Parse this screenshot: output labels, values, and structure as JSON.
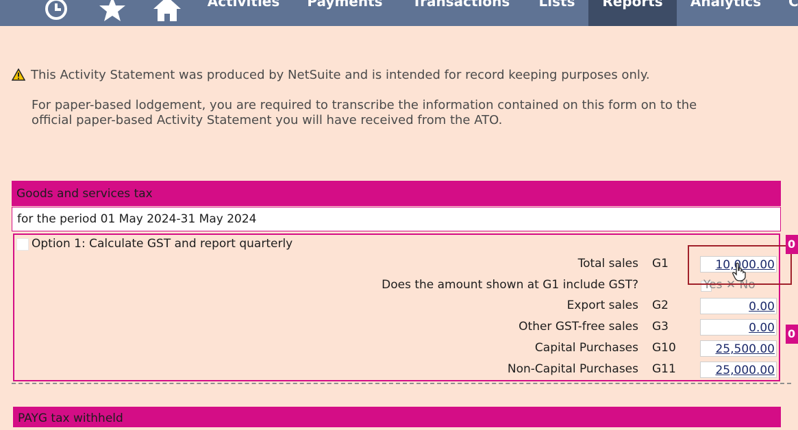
{
  "nav": {
    "icons": [
      "history-icon",
      "star-icon",
      "home-icon"
    ],
    "items": [
      {
        "label": "Activities"
      },
      {
        "label": "Payments"
      },
      {
        "label": "Transactions"
      },
      {
        "label": "Lists"
      },
      {
        "label": "Reports",
        "active": true
      },
      {
        "label": "Analytics"
      },
      {
        "label": "C"
      }
    ]
  },
  "notice": {
    "line1": "This Activity Statement was produced by NetSuite and is intended for record keeping purposes only.",
    "line2": "For paper-based lodgement, you are required to transcribe the information contained on this form on to the",
    "line3": "official paper-based Activity Statement you will have received from the ATO."
  },
  "gst": {
    "header": "Goods and services tax",
    "period": "for the period 01 May 2024-31 May 2024",
    "option_label": "Option 1: Calculate GST and report quarterly",
    "rows": [
      {
        "label": "Total sales",
        "code": "G1",
        "value": "10,000.00"
      },
      {
        "label": "Does the amount shown at G1 include GST?",
        "code": "",
        "yes": "Yes",
        "no": "No"
      },
      {
        "label": "Export sales",
        "code": "G2",
        "value": "0.00"
      },
      {
        "label": "Other GST-free sales",
        "code": "G3",
        "value": "0.00"
      },
      {
        "label": "Capital Purchases",
        "code": "G10",
        "value": "25,500.00"
      },
      {
        "label": "Non-Capital Purchases",
        "code": "G11",
        "value": "25,000.00"
      }
    ],
    "side_tabs": [
      "0",
      "0"
    ]
  },
  "payg": {
    "header": "PAYG tax withheld"
  },
  "colors": {
    "nav_bg": "#5f7394",
    "nav_active": "#3d4c66",
    "page_bg": "#fde3d4",
    "section_header": "#d40d86",
    "amount_link": "#1c2a6b",
    "highlight_border": "#a0202a"
  }
}
